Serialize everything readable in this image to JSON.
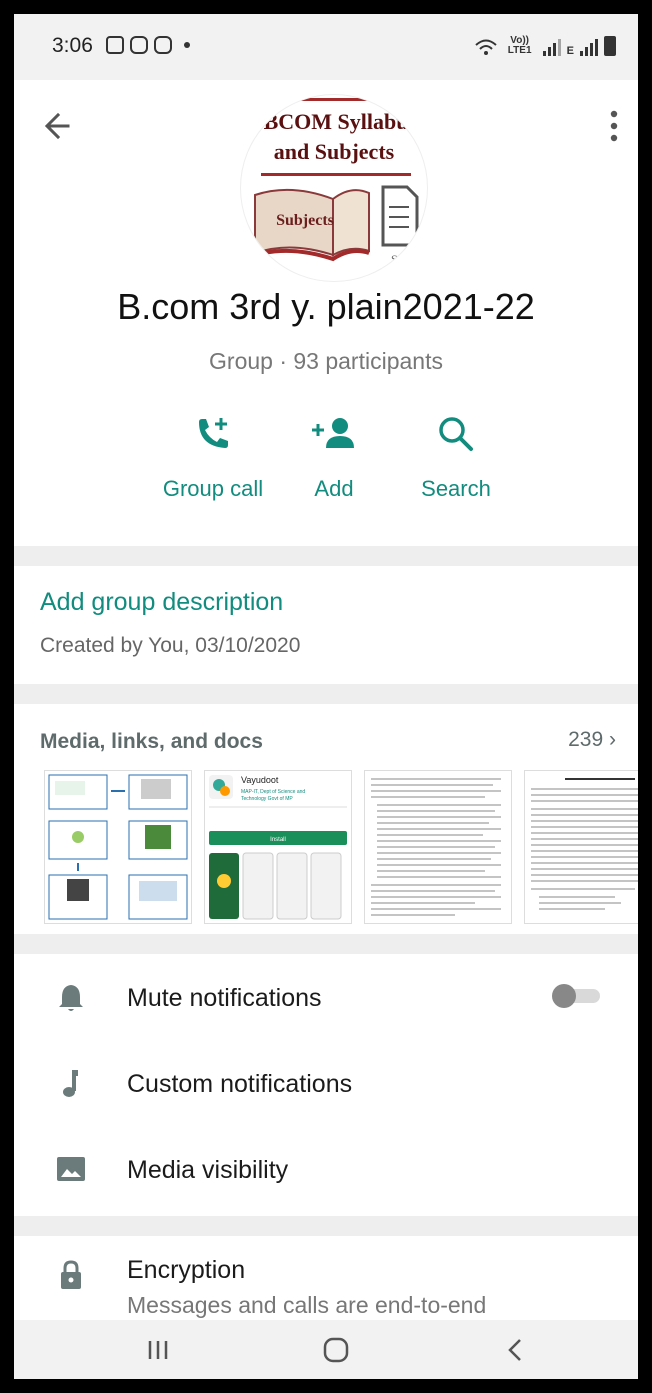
{
  "status_bar": {
    "time": "3:06",
    "network": "Vo)) LTE1",
    "data_indicator": "E"
  },
  "header": {
    "back_icon": "arrow-left-icon",
    "menu_icon": "more-vert-icon",
    "avatar_text_line1": "BCOM Syllabu",
    "avatar_text_line2": "and Subjects",
    "avatar_book_label": "Subjects",
    "avatar_doc_label": "Sylb",
    "title": "B.com 3rd y. plain2021-22",
    "subtitle": "Group · 93 participants"
  },
  "actions": [
    {
      "label": "Group call",
      "icon": "phone-add-icon"
    },
    {
      "label": "Add",
      "icon": "person-add-icon"
    },
    {
      "label": "Search",
      "icon": "search-icon"
    }
  ],
  "description": {
    "add_label": "Add group description",
    "created": "Created by You, 03/10/2020"
  },
  "media": {
    "title": "Media, links, and docs",
    "count": "239",
    "thumb2": {
      "app_name": "Vayudoot",
      "publisher_line1": "MAP-IT, Dept of Science and",
      "publisher_line2": "Technology Govt of MP",
      "install": "Install"
    }
  },
  "settings": {
    "mute": "Mute notifications",
    "custom": "Custom notifications",
    "media_visibility": "Media visibility",
    "mute_enabled": false
  },
  "encryption": {
    "title": "Encryption",
    "subtitle": "Messages and calls are end-to-end"
  },
  "colors": {
    "accent": "#128c7e",
    "icon_gray": "#6b7b7b"
  }
}
